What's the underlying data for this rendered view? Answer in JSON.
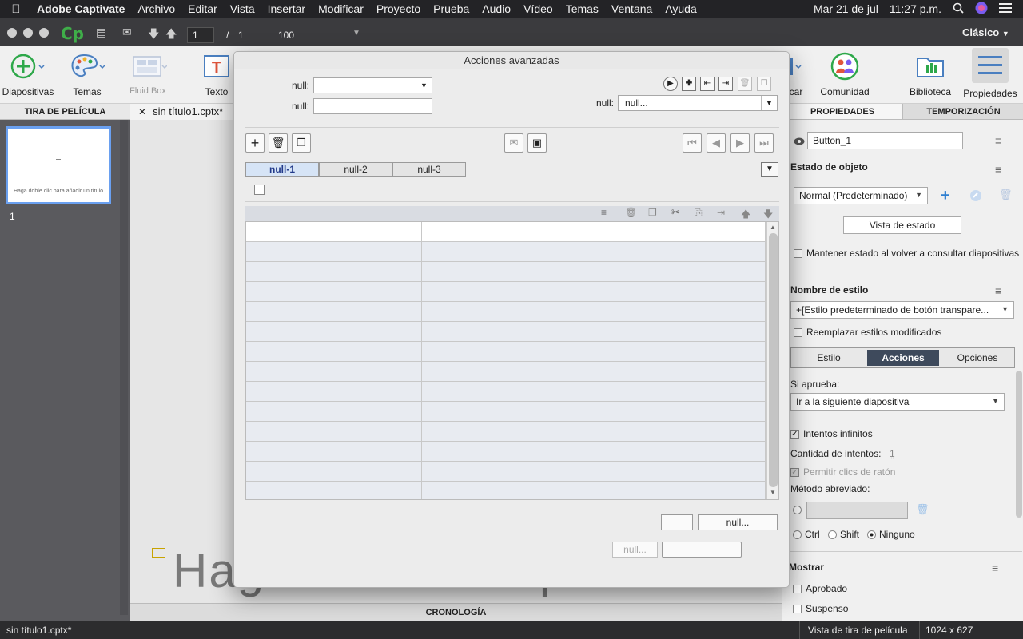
{
  "menubar": {
    "app": "Adobe Captivate",
    "items": [
      "Archivo",
      "Editar",
      "Vista",
      "Insertar",
      "Modificar",
      "Proyecto",
      "Prueba",
      "Audio",
      "Vídeo",
      "Temas",
      "Ventana",
      "Ayuda"
    ],
    "date": "Mar 21 de jul",
    "time": "11:27 p.m."
  },
  "titlebar": {
    "logo": "Cp",
    "slide_current": "1",
    "slide_separator": "/",
    "slide_total": "1",
    "zoom": "100",
    "workspace": "Clásico"
  },
  "toolbar": {
    "left": [
      "Diapositivas",
      "Temas",
      "Fluid Box",
      "Texto"
    ],
    "right": [
      "car",
      "Comunidad",
      "Biblioteca",
      "Propiedades"
    ]
  },
  "filmstrip": {
    "header": "TIRA DE PELÍCULA",
    "thumb_text": "Haga doble clic para añadir un título",
    "slide_number": "1"
  },
  "document": {
    "tab": "sin título1.cptx*",
    "stage_text": "Haga doble clic para añadir un título",
    "timeline": "CRONOLOGÍA"
  },
  "statusbar": {
    "file": "sin título1.cptx*",
    "view": "Vista de tira de película",
    "size": "1024 x 627"
  },
  "properties": {
    "tabs": [
      "PROPIEDADES",
      "TEMPORIZACIÓN"
    ],
    "name": "Button_1",
    "object_state_label": "Estado de objeto",
    "state_value": "Normal (Predeterminado)",
    "state_view_btn": "Vista de estado",
    "keep_state": "Mantener estado al volver a consultar diapositivas",
    "style_name_label": "Nombre de estilo",
    "style_value": "+[Estilo predeterminado de botón transpare...",
    "replace_styles": "Reemplazar estilos modificados",
    "subtabs": [
      "Estilo",
      "Acciones",
      "Opciones"
    ],
    "on_success_label": "Si aprueba:",
    "on_success_value": "Ir a la siguiente diapositiva",
    "infinite_attempts": "Intentos infinitos",
    "attempts_label": "Cantidad de intentos:",
    "attempts_value": "1",
    "mouse_clicks": "Permitir clics de ratón",
    "shortcut_label": "Método abreviado:",
    "modifiers": [
      "Ctrl",
      "Shift",
      "Ninguno"
    ],
    "show_label": "Mostrar",
    "show_items": [
      "Aprobado",
      "Suspenso"
    ]
  },
  "dialog": {
    "title": "Acciones avanzadas",
    "label1": "null:",
    "label2": "null:",
    "label3": "null:",
    "select3_value": "null...",
    "tabs": [
      "null-1",
      "null-2",
      "null-3"
    ],
    "btn_primary": "null...",
    "btn_disabled": "null..."
  }
}
